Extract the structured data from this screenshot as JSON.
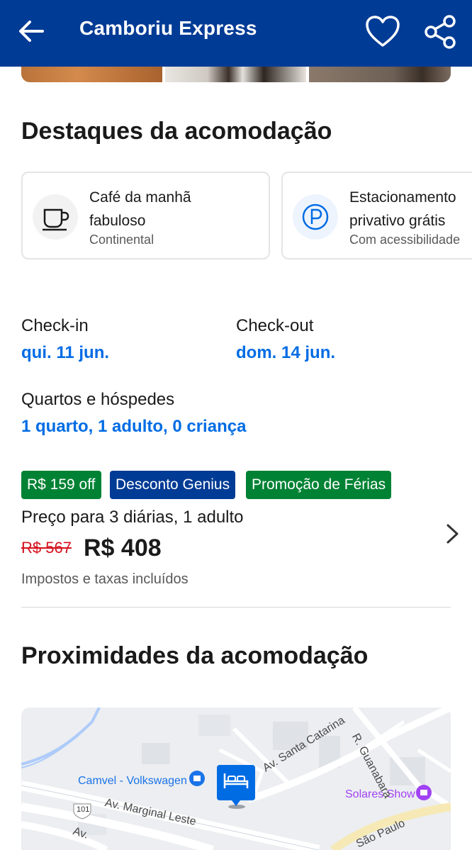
{
  "header": {
    "title": "Camboriu Express",
    "back_icon": "arrow-left-icon",
    "favorite_icon": "heart-icon",
    "share_icon": "share-icon"
  },
  "highlights": {
    "heading": "Destaques da acomodação",
    "items": [
      {
        "line1": "Café da manhã",
        "line2": "fabuloso",
        "sub": "Continental",
        "icon": "coffee-cup-icon"
      },
      {
        "line1": "Estacionamento",
        "line2": "privativo grátis",
        "sub": "Com acessibilidade",
        "icon": "parking-icon"
      }
    ]
  },
  "dates": {
    "checkin_label": "Check-in",
    "checkin_value": "qui. 11 jun.",
    "checkout_label": "Check-out",
    "checkout_value": "dom. 14 jun."
  },
  "rooms": {
    "label": "Quartos e hóspedes",
    "value": "1 quarto, 1 adulto, 0 criança"
  },
  "pricing": {
    "badges": [
      {
        "text": "R$ 159 off",
        "color": "#008234"
      },
      {
        "text": "Desconto Genius",
        "color": "#003b95"
      },
      {
        "text": "Promoção de Férias",
        "color": "#008234"
      }
    ],
    "price_for": "Preço para 3 diárias, 1 adulto",
    "old_price": "R$ 567",
    "new_price": "R$ 408",
    "taxes_note": "Impostos e taxas incluídos"
  },
  "nearby": {
    "heading": "Proximidades da acomodação",
    "map_labels": {
      "camvel": "Camvel - Volkswagen",
      "solares": "Solares Show",
      "santa_catarina": "Av. Santa Catarina",
      "guanabara": "R. Guanabara",
      "marginal": "Av. Marginal Leste",
      "route": "101",
      "sao_paulo": "São Paulo",
      "av_partial": "Av."
    }
  },
  "colors": {
    "brand": "#003b95",
    "link": "#006ce4",
    "green": "#008234",
    "strike": "#d4111e"
  }
}
